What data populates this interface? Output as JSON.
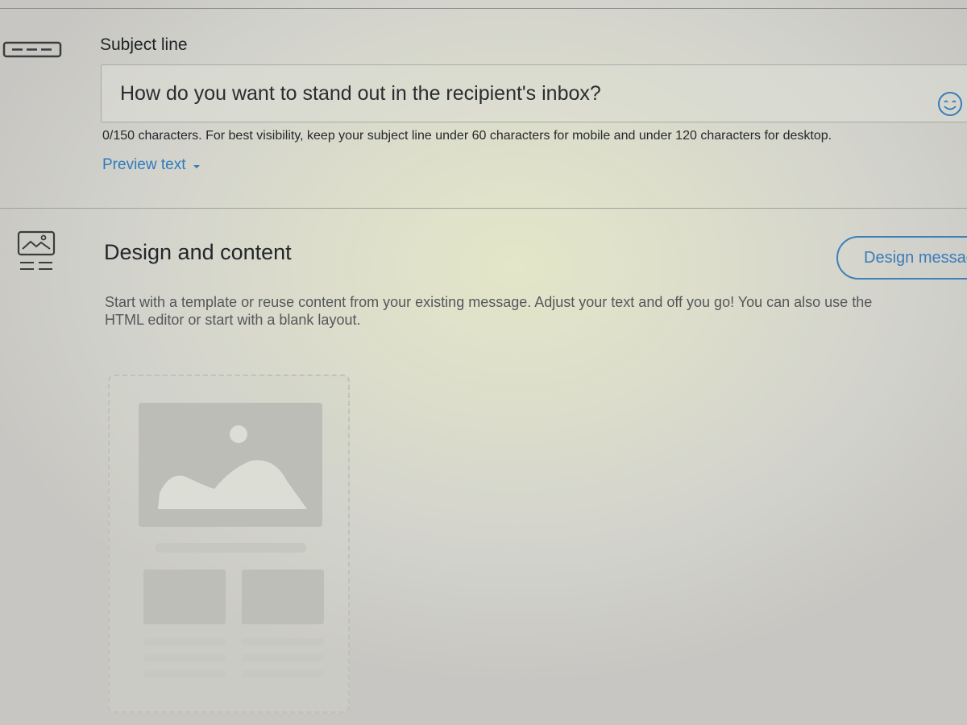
{
  "subject_section": {
    "icon": "subject-line-icon",
    "label": "Subject line",
    "input": {
      "value": "",
      "placeholder": "How do you want to stand out in the recipient's inbox?"
    },
    "emoji_icon": "smiley-icon",
    "char_hint": "0/150 characters. For best visibility, keep your subject line under 60 characters for mobile and under 120 characters for desktop.",
    "preview_link": "Preview text",
    "preview_icon": "caret-down-icon"
  },
  "design_section": {
    "icon": "design-layout-icon",
    "title": "Design and content",
    "button_label": "Design message",
    "description_line1": "Start with a template or reuse content from your existing message. Adjust your text and off you go! You can also use the",
    "description_line2": "HTML editor or start with a blank layout.",
    "template_illustration": "template-placeholder-illustration"
  },
  "colors": {
    "link": "#2e7bbd",
    "button_border": "#3f80bb",
    "text": "#2b2f31"
  }
}
